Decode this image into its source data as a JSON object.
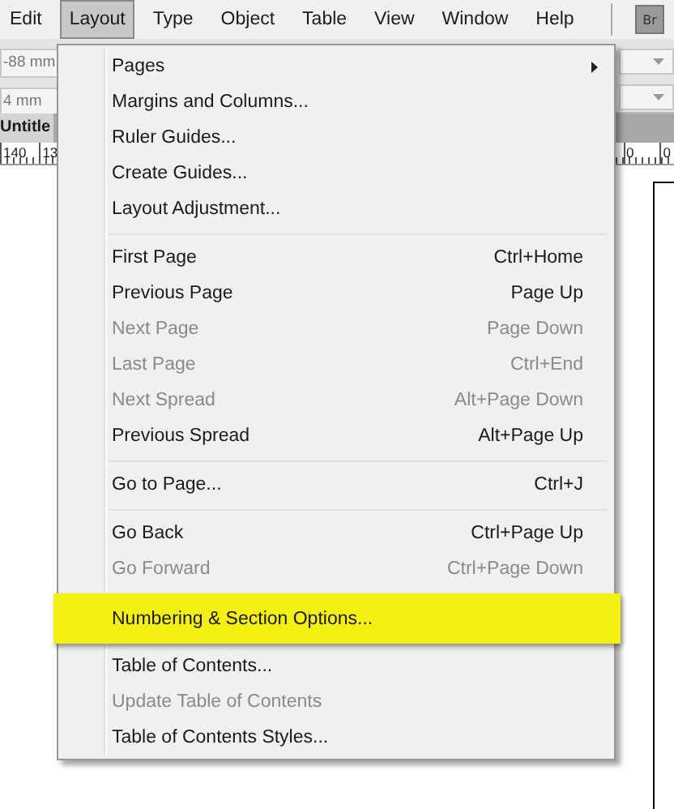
{
  "menubar": {
    "items": [
      {
        "label": "Edit",
        "selected": false
      },
      {
        "label": "Layout",
        "selected": true
      },
      {
        "label": "Type",
        "selected": false
      },
      {
        "label": "Object",
        "selected": false
      },
      {
        "label": "Table",
        "selected": false
      },
      {
        "label": "View",
        "selected": false
      },
      {
        "label": "Window",
        "selected": false
      },
      {
        "label": "Help",
        "selected": false
      }
    ],
    "bridge_button": "Br"
  },
  "control_bar": {
    "fields": [
      "-88 mm",
      "4 mm"
    ]
  },
  "document_tab": "Untitle",
  "ruler": {
    "left_labels": [
      "140",
      "13"
    ],
    "right_labels": [
      "0",
      "0"
    ]
  },
  "menu": {
    "groups": [
      {
        "items": [
          {
            "label": "Pages",
            "disabled": false,
            "submenu": true,
            "highlighted": false
          },
          {
            "label": "Margins and Columns...",
            "disabled": false,
            "submenu": false,
            "highlighted": false
          },
          {
            "label": "Ruler Guides...",
            "disabled": false,
            "submenu": false,
            "highlighted": false
          },
          {
            "label": "Create Guides...",
            "disabled": false,
            "submenu": false,
            "highlighted": false
          },
          {
            "label": "Layout Adjustment...",
            "disabled": false,
            "submenu": false,
            "highlighted": false
          }
        ]
      },
      {
        "items": [
          {
            "label": "First Page",
            "shortcut": "Ctrl+Home",
            "disabled": false,
            "submenu": false,
            "highlighted": false
          },
          {
            "label": "Previous Page",
            "shortcut": "Page Up",
            "disabled": false,
            "submenu": false,
            "highlighted": false
          },
          {
            "label": "Next Page",
            "shortcut": "Page Down",
            "disabled": true,
            "submenu": false,
            "highlighted": false
          },
          {
            "label": "Last Page",
            "shortcut": "Ctrl+End",
            "disabled": true,
            "submenu": false,
            "highlighted": false
          },
          {
            "label": "Next Spread",
            "shortcut": "Alt+Page Down",
            "disabled": true,
            "submenu": false,
            "highlighted": false
          },
          {
            "label": "Previous Spread",
            "shortcut": "Alt+Page Up",
            "disabled": false,
            "submenu": false,
            "highlighted": false
          }
        ]
      },
      {
        "items": [
          {
            "label": "Go to Page...",
            "shortcut": "Ctrl+J",
            "disabled": false,
            "submenu": false,
            "highlighted": false
          }
        ]
      },
      {
        "items": [
          {
            "label": "Go Back",
            "shortcut": "Ctrl+Page Up",
            "disabled": false,
            "submenu": false,
            "highlighted": false
          },
          {
            "label": "Go Forward",
            "shortcut": "Ctrl+Page Down",
            "disabled": true,
            "submenu": false,
            "highlighted": false
          }
        ]
      },
      {
        "items": [
          {
            "label": "Numbering & Section Options...",
            "disabled": false,
            "submenu": false,
            "highlighted": true
          }
        ]
      },
      {
        "items": [
          {
            "label": "Table of Contents...",
            "disabled": false,
            "submenu": false,
            "highlighted": false
          },
          {
            "label": "Update Table of Contents",
            "disabled": true,
            "submenu": false,
            "highlighted": false
          },
          {
            "label": "Table of Contents Styles...",
            "disabled": false,
            "submenu": false,
            "highlighted": false
          }
        ]
      }
    ]
  }
}
